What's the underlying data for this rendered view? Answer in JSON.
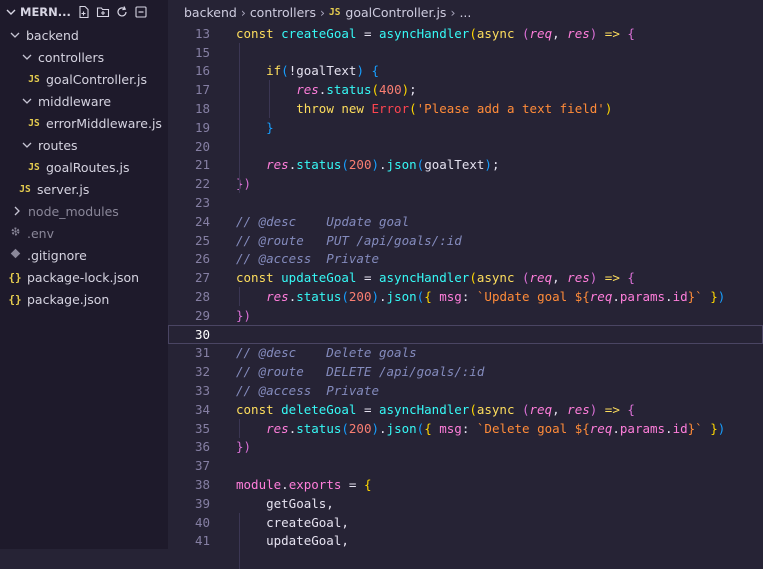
{
  "explorer": {
    "root_label": "MERN...",
    "items": [
      {
        "label": "backend",
        "type": "folder-open",
        "depth": 0
      },
      {
        "label": "controllers",
        "type": "folder-open",
        "depth": 1
      },
      {
        "label": "goalController.js",
        "type": "js",
        "depth": 2
      },
      {
        "label": "middleware",
        "type": "folder-open",
        "depth": 1
      },
      {
        "label": "errorMiddleware.js",
        "type": "js",
        "depth": 2
      },
      {
        "label": "routes",
        "type": "folder-open",
        "depth": 1
      },
      {
        "label": "goalRoutes.js",
        "type": "js",
        "depth": 2
      },
      {
        "label": "server.js",
        "type": "js",
        "depth": 1
      },
      {
        "label": "node_modules",
        "type": "folder-closed",
        "depth": 0
      },
      {
        "label": ".env",
        "type": "gear",
        "depth": 0
      },
      {
        "label": ".gitignore",
        "type": "diamond",
        "depth": 0
      },
      {
        "label": "package-lock.json",
        "type": "json",
        "depth": 0
      },
      {
        "label": "package.json",
        "type": "json",
        "depth": 0
      }
    ],
    "icons": {
      "js": "JS",
      "json": "{}"
    }
  },
  "breadcrumb": {
    "parts": [
      "backend",
      "controllers",
      "goalController.js",
      "..."
    ],
    "file_badge": "JS"
  },
  "editor": {
    "active_line": 30,
    "lines": [
      {
        "n": "13",
        "tokens": [
          [
            "kw",
            "const "
          ],
          [
            "fn",
            "createGoal"
          ],
          [
            "txt",
            " = "
          ],
          [
            "fn",
            "asyncHandler"
          ],
          [
            "b1",
            "("
          ],
          [
            "kw",
            "async "
          ],
          [
            "b2",
            "("
          ],
          [
            "param",
            "req"
          ],
          [
            "txt",
            ", "
          ],
          [
            "param",
            "res"
          ],
          [
            "b2",
            ")"
          ],
          [
            "kw",
            " => "
          ],
          [
            "b2",
            "{"
          ]
        ]
      },
      {
        "n": "15",
        "tokens": []
      },
      {
        "n": "16",
        "tokens": [
          [
            "txt",
            "    "
          ],
          [
            "kw",
            "if"
          ],
          [
            "b3",
            "("
          ],
          [
            "txt",
            "!goalText"
          ],
          [
            "b3",
            ")"
          ],
          [
            "txt",
            " "
          ],
          [
            "b3",
            "{"
          ]
        ]
      },
      {
        "n": "17",
        "tokens": [
          [
            "txt",
            "        "
          ],
          [
            "param",
            "res"
          ],
          [
            "txt",
            "."
          ],
          [
            "fn",
            "status"
          ],
          [
            "b1",
            "("
          ],
          [
            "num",
            "400"
          ],
          [
            "b1",
            ")"
          ],
          [
            "txt",
            ";"
          ]
        ]
      },
      {
        "n": "18",
        "tokens": [
          [
            "txt",
            "        "
          ],
          [
            "kw",
            "throw new "
          ],
          [
            "cls",
            "Error"
          ],
          [
            "b1",
            "("
          ],
          [
            "str",
            "'Please add a text field'"
          ],
          [
            "b1",
            ")"
          ]
        ]
      },
      {
        "n": "19",
        "tokens": [
          [
            "txt",
            "    "
          ],
          [
            "b3",
            "}"
          ]
        ]
      },
      {
        "n": "20",
        "tokens": []
      },
      {
        "n": "21",
        "tokens": [
          [
            "txt",
            "    "
          ],
          [
            "param",
            "res"
          ],
          [
            "txt",
            "."
          ],
          [
            "fn",
            "status"
          ],
          [
            "b3",
            "("
          ],
          [
            "num",
            "200"
          ],
          [
            "b3",
            ")"
          ],
          [
            "txt",
            "."
          ],
          [
            "fn",
            "json"
          ],
          [
            "b3",
            "("
          ],
          [
            "txt",
            "goalText"
          ],
          [
            "b3",
            ")"
          ],
          [
            "txt",
            ";"
          ]
        ]
      },
      {
        "n": "22",
        "tokens": [
          [
            "b2",
            "})"
          ]
        ]
      },
      {
        "n": "23",
        "tokens": []
      },
      {
        "n": "24",
        "tokens": [
          [
            "cmt",
            "// @desc    Update goal"
          ]
        ]
      },
      {
        "n": "25",
        "tokens": [
          [
            "cmt",
            "// @route   PUT /api/goals/:id"
          ]
        ]
      },
      {
        "n": "26",
        "tokens": [
          [
            "cmt",
            "// @access  Private"
          ]
        ]
      },
      {
        "n": "27",
        "tokens": [
          [
            "kw",
            "const "
          ],
          [
            "fn",
            "updateGoal"
          ],
          [
            "txt",
            " = "
          ],
          [
            "fn",
            "asyncHandler"
          ],
          [
            "b1",
            "("
          ],
          [
            "kw",
            "async "
          ],
          [
            "b2",
            "("
          ],
          [
            "param",
            "req"
          ],
          [
            "txt",
            ", "
          ],
          [
            "param",
            "res"
          ],
          [
            "b2",
            ")"
          ],
          [
            "kw",
            " => "
          ],
          [
            "b2",
            "{"
          ]
        ]
      },
      {
        "n": "28",
        "tokens": [
          [
            "txt",
            "    "
          ],
          [
            "param",
            "res"
          ],
          [
            "txt",
            "."
          ],
          [
            "fn",
            "status"
          ],
          [
            "b3",
            "("
          ],
          [
            "num",
            "200"
          ],
          [
            "b3",
            ")"
          ],
          [
            "txt",
            "."
          ],
          [
            "fn",
            "json"
          ],
          [
            "b3",
            "("
          ],
          [
            "b1",
            "{ "
          ],
          [
            "prop",
            "msg"
          ],
          [
            "txt",
            ": "
          ],
          [
            "str",
            "`Update goal ${"
          ],
          [
            "param",
            "req"
          ],
          [
            "txt",
            "."
          ],
          [
            "prop",
            "params"
          ],
          [
            "txt",
            "."
          ],
          [
            "prop",
            "id"
          ],
          [
            "str",
            "}`"
          ],
          [
            "b1",
            " }"
          ],
          [
            "b3",
            ")"
          ]
        ]
      },
      {
        "n": "29",
        "tokens": [
          [
            "b2",
            "})"
          ]
        ]
      },
      {
        "n": "30",
        "tokens": []
      },
      {
        "n": "31",
        "tokens": [
          [
            "cmt",
            "// @desc    Delete goals"
          ]
        ]
      },
      {
        "n": "32",
        "tokens": [
          [
            "cmt",
            "// @route   DELETE /api/goals/:id"
          ]
        ]
      },
      {
        "n": "33",
        "tokens": [
          [
            "cmt",
            "// @access  Private"
          ]
        ]
      },
      {
        "n": "34",
        "tokens": [
          [
            "kw",
            "const "
          ],
          [
            "fn",
            "deleteGoal"
          ],
          [
            "txt",
            " = "
          ],
          [
            "fn",
            "asyncHandler"
          ],
          [
            "b1",
            "("
          ],
          [
            "kw",
            "async "
          ],
          [
            "b2",
            "("
          ],
          [
            "param",
            "req"
          ],
          [
            "txt",
            ", "
          ],
          [
            "param",
            "res"
          ],
          [
            "b2",
            ")"
          ],
          [
            "kw",
            " => "
          ],
          [
            "b2",
            "{"
          ]
        ]
      },
      {
        "n": "35",
        "tokens": [
          [
            "txt",
            "    "
          ],
          [
            "param",
            "res"
          ],
          [
            "txt",
            "."
          ],
          [
            "fn",
            "status"
          ],
          [
            "b3",
            "("
          ],
          [
            "num",
            "200"
          ],
          [
            "b3",
            ")"
          ],
          [
            "txt",
            "."
          ],
          [
            "fn",
            "json"
          ],
          [
            "b3",
            "("
          ],
          [
            "b1",
            "{ "
          ],
          [
            "prop",
            "msg"
          ],
          [
            "txt",
            ": "
          ],
          [
            "str",
            "`Delete goal ${"
          ],
          [
            "param",
            "req"
          ],
          [
            "txt",
            "."
          ],
          [
            "prop",
            "params"
          ],
          [
            "txt",
            "."
          ],
          [
            "prop",
            "id"
          ],
          [
            "str",
            "}`"
          ],
          [
            "b1",
            " }"
          ],
          [
            "b3",
            ")"
          ]
        ]
      },
      {
        "n": "36",
        "tokens": [
          [
            "b2",
            "})"
          ]
        ]
      },
      {
        "n": "37",
        "tokens": []
      },
      {
        "n": "38",
        "tokens": [
          [
            "prop",
            "module"
          ],
          [
            "txt",
            "."
          ],
          [
            "prop",
            "exports"
          ],
          [
            "txt",
            " = "
          ],
          [
            "b1",
            "{"
          ]
        ]
      },
      {
        "n": "39",
        "tokens": [
          [
            "txt",
            "    getGoals,"
          ]
        ]
      },
      {
        "n": "40",
        "tokens": [
          [
            "txt",
            "    createGoal,"
          ]
        ]
      },
      {
        "n": "41",
        "tokens": [
          [
            "txt",
            "    updateGoal,"
          ]
        ]
      }
    ]
  },
  "colors": {
    "editor_bg": "#262335",
    "sidebar_bg": "#1e1a2b",
    "keyword": "#fede5d",
    "function": "#36f9f6",
    "param": "#ff7edb",
    "string": "#ff8b39",
    "number": "#f97e72",
    "comment": "#848bbd"
  }
}
